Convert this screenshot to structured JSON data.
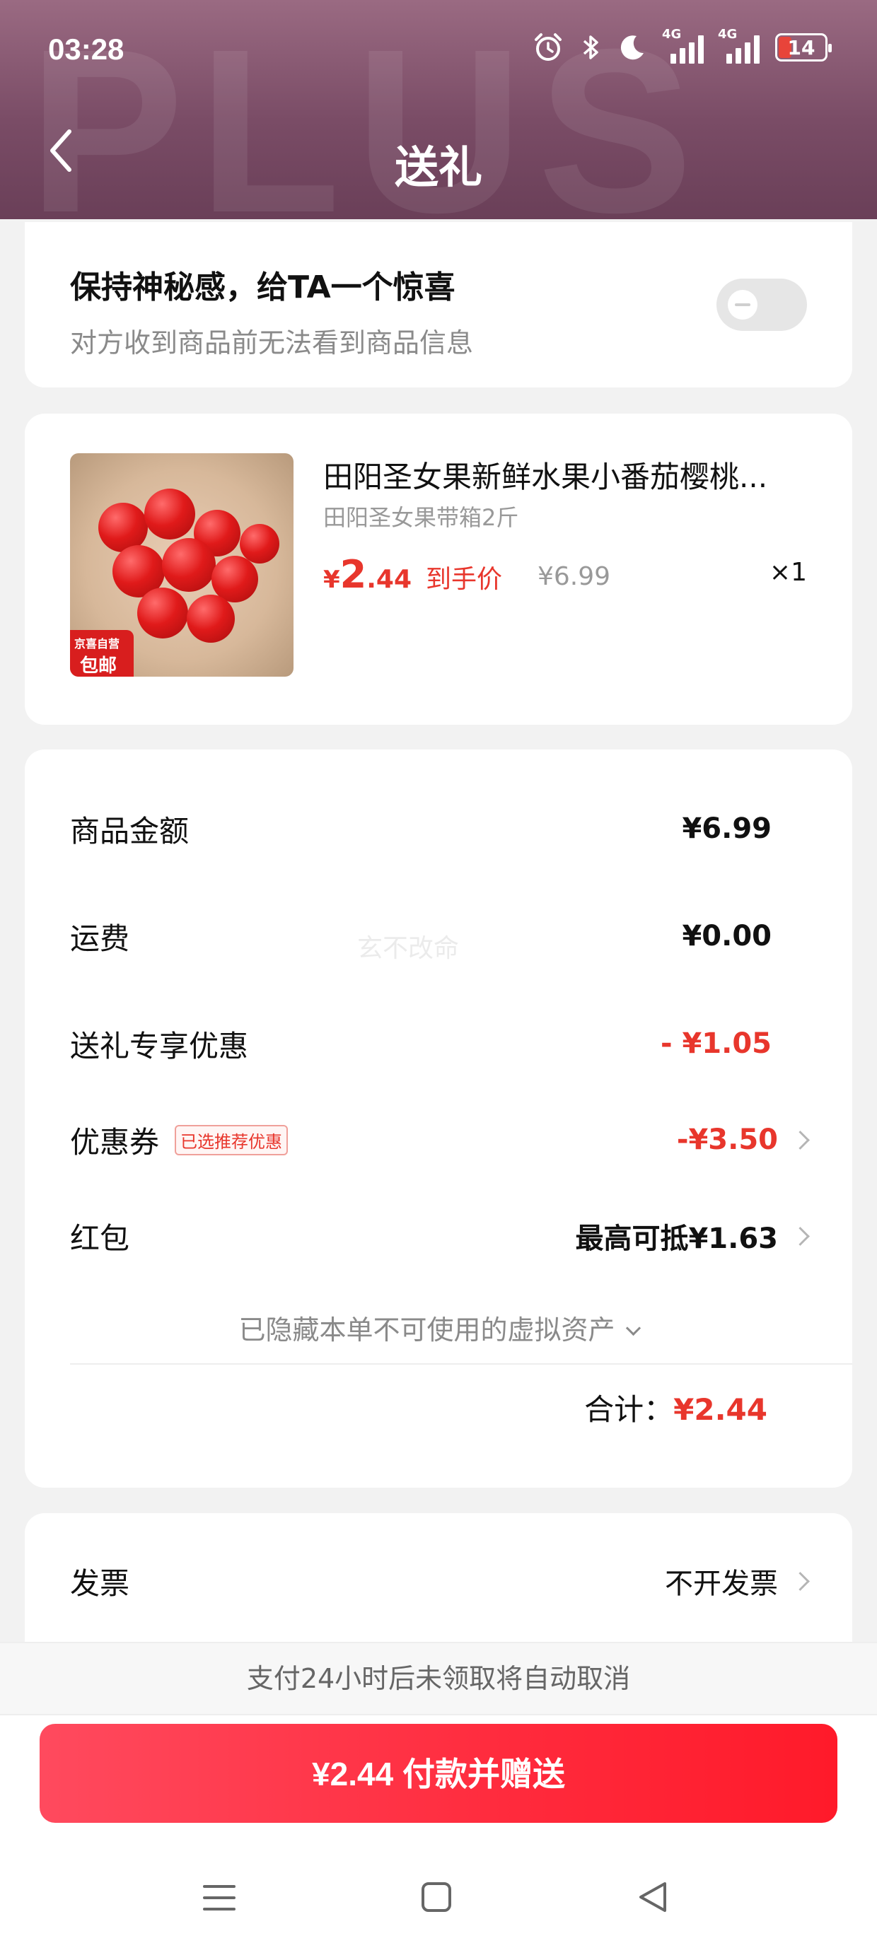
{
  "status_bar": {
    "time": "03:28",
    "network_1": "4G",
    "network_2": "4G",
    "battery": "14"
  },
  "header": {
    "title": "送礼",
    "background_text": "PLUS"
  },
  "surprise": {
    "title": "保持神秘感，给TA一个惊喜",
    "subtitle": "对方收到商品前无法看到商品信息",
    "enabled": false
  },
  "product": {
    "name": "田阳圣女果新鲜水果小番茄樱桃...",
    "spec": "田阳圣女果带箱2斤",
    "price_currency": "¥",
    "price_int": "2",
    "price_dec": ".44",
    "price_tag": "到手价",
    "original_price": "¥6.99",
    "quantity": "×1",
    "badge_line1": "京喜自营",
    "badge_line2": "包邮"
  },
  "summary": {
    "rows": [
      {
        "label": "商品金额",
        "value": "¥6.99"
      },
      {
        "label": "运费",
        "value": "¥0.00"
      },
      {
        "label": "送礼专享优惠",
        "value": "- ¥1.05"
      },
      {
        "label": "优惠券",
        "tag": "已选推荐优惠",
        "value": "-¥3.50"
      },
      {
        "label": "红包",
        "value": "最高可抵¥1.63"
      }
    ],
    "hidden_assets": "已隐藏本单不可使用的虚拟资产",
    "total_label": "合计：",
    "total_value": "¥2.44"
  },
  "invoice": {
    "label": "发票",
    "value": "不开发票"
  },
  "notice": "支付24小时后未领取将自动取消",
  "pay_button": "¥2.44 付款并赠送",
  "watermark": "玄不改命",
  "colors": {
    "accent": "#e8362c",
    "header": "#7a4c66",
    "button": "#ff2a3c"
  }
}
